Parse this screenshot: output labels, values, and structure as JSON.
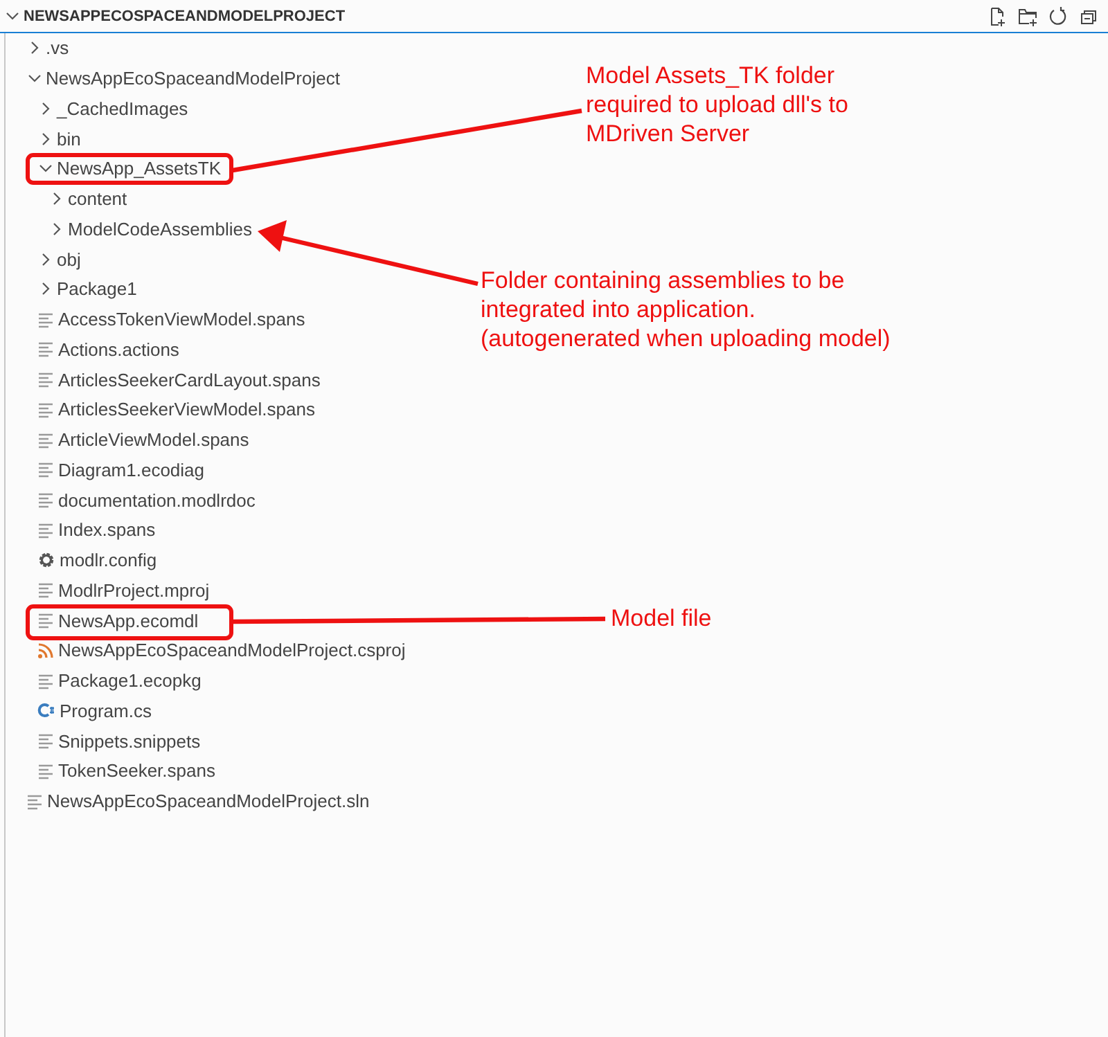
{
  "explorer": {
    "title": "NEWSAPPECOSPACEANDMODELPROJECT",
    "expanded": true
  },
  "tree": [
    {
      "label": ".vs",
      "kind": "folder",
      "expanded": false
    },
    {
      "label": "NewsAppEcoSpaceandModelProject",
      "kind": "folder",
      "expanded": true,
      "children": [
        {
          "label": "_CachedImages",
          "kind": "folder",
          "expanded": false
        },
        {
          "label": "bin",
          "kind": "folder",
          "expanded": false
        },
        {
          "label": "NewsApp_AssetsTK",
          "kind": "folder",
          "expanded": true,
          "children": [
            {
              "label": "content",
              "kind": "folder",
              "expanded": false
            },
            {
              "label": "ModelCodeAssemblies",
              "kind": "folder",
              "expanded": false
            }
          ]
        },
        {
          "label": "obj",
          "kind": "folder",
          "expanded": false
        },
        {
          "label": "Package1",
          "kind": "folder",
          "expanded": false
        },
        {
          "label": "AccessTokenViewModel.spans",
          "kind": "text-file"
        },
        {
          "label": "Actions.actions",
          "kind": "text-file"
        },
        {
          "label": "ArticlesSeekerCardLayout.spans",
          "kind": "text-file"
        },
        {
          "label": "ArticlesSeekerViewModel.spans",
          "kind": "text-file"
        },
        {
          "label": "ArticleViewModel.spans",
          "kind": "text-file"
        },
        {
          "label": "Diagram1.ecodiag",
          "kind": "text-file"
        },
        {
          "label": "documentation.modlrdoc",
          "kind": "text-file"
        },
        {
          "label": "Index.spans",
          "kind": "text-file"
        },
        {
          "label": "modlr.config",
          "kind": "config-file"
        },
        {
          "label": "ModlrProject.mproj",
          "kind": "text-file"
        },
        {
          "label": "NewsApp.ecomdl",
          "kind": "text-file"
        },
        {
          "label": "NewsAppEcoSpaceandModelProject.csproj",
          "kind": "feed-file"
        },
        {
          "label": "Package1.ecopkg",
          "kind": "text-file"
        },
        {
          "label": "Program.cs",
          "kind": "csharp-file"
        },
        {
          "label": "Snippets.snippets",
          "kind": "text-file"
        },
        {
          "label": "TokenSeeker.spans",
          "kind": "text-file"
        }
      ]
    },
    {
      "label": "NewsAppEcoSpaceandModelProject.sln",
      "kind": "text-file"
    }
  ],
  "annotations": [
    {
      "text": "Model Assets_TK folder\nrequired to upload dll's to\nMDriven Server",
      "kind": "line"
    },
    {
      "text": "Folder containing assemblies to be\nintegrated into application.\n(autogenerated when uploading model)",
      "kind": "arrow"
    },
    {
      "text": "Model file",
      "kind": "line"
    }
  ]
}
